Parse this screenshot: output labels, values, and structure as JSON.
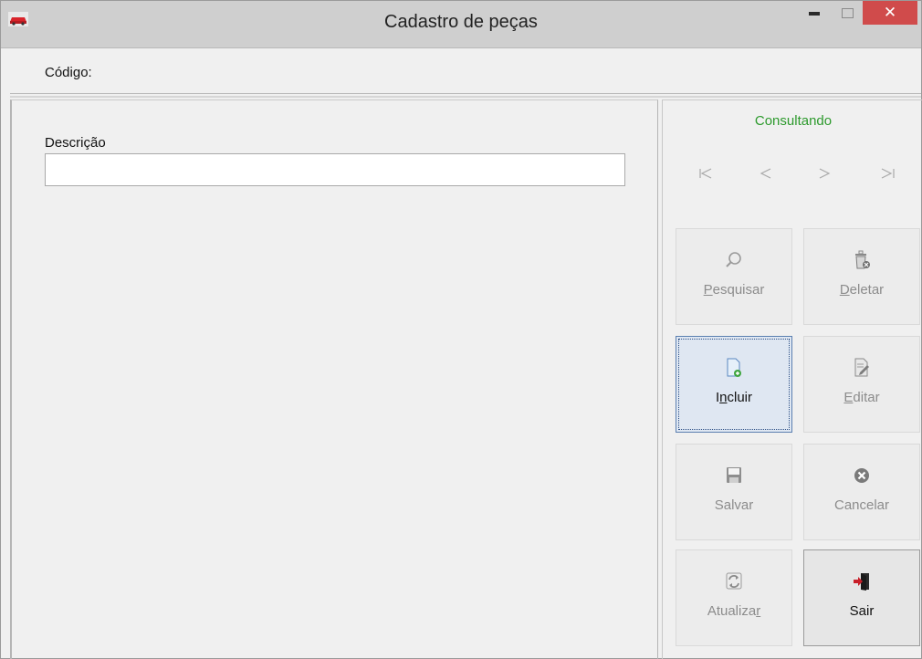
{
  "window": {
    "title": "Cadastro de peças",
    "close_glyph": "✕"
  },
  "form": {
    "codigo_label": "Código:",
    "descricao_label": "Descrição",
    "descricao_value": ""
  },
  "status": {
    "text": "Consultando",
    "color": "#2d9a2d"
  },
  "navigation": {
    "first": {
      "icon": "first-record-icon"
    },
    "previous": {
      "icon": "previous-record-icon"
    },
    "next": {
      "icon": "next-record-icon"
    },
    "last": {
      "icon": "last-record-icon"
    }
  },
  "buttons": {
    "pesquisar": {
      "pre": "",
      "u": "P",
      "post": "esquisar",
      "icon": "search-icon",
      "enabled": false
    },
    "deletar": {
      "pre": "",
      "u": "D",
      "post": "eletar",
      "icon": "trash-icon",
      "enabled": false
    },
    "incluir": {
      "pre": "I",
      "u": "n",
      "post": "cluir",
      "icon": "new-document-icon",
      "enabled": true
    },
    "editar": {
      "pre": "",
      "u": "E",
      "post": "ditar",
      "icon": "edit-document-icon",
      "enabled": false
    },
    "salvar": {
      "label": "Salvar",
      "icon": "floppy-disk-icon",
      "enabled": false
    },
    "cancelar": {
      "label": "Cancelar",
      "icon": "cancel-icon",
      "enabled": false
    },
    "atualizar": {
      "pre": "Atualiza",
      "u": "r",
      "post": "",
      "icon": "refresh-icon",
      "enabled": false
    },
    "sair": {
      "label": "Sair",
      "icon": "exit-icon",
      "enabled": true
    }
  }
}
